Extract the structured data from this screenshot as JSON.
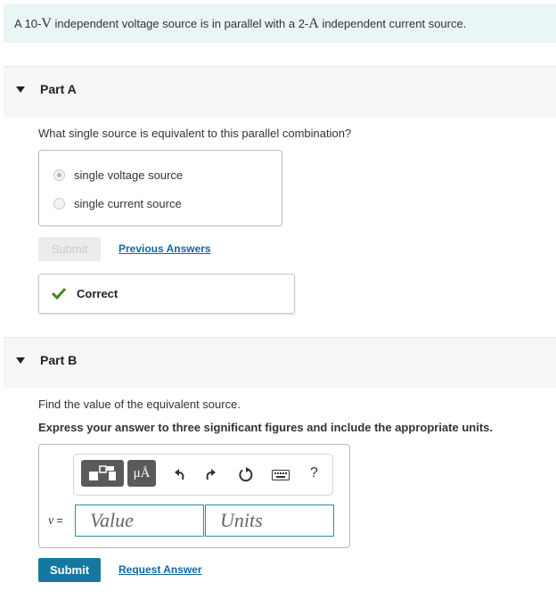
{
  "intro": {
    "pre_v": "A 10-",
    "v_symbol": "V",
    "mid": " independent voltage source is in parallel with a 2-",
    "a_symbol": "A",
    "post": " independent current source."
  },
  "part_a": {
    "label": "Part A",
    "question": "What single source is equivalent to this parallel combination?",
    "choices": [
      {
        "label": "single voltage source",
        "selected": true
      },
      {
        "label": "single current source",
        "selected": false
      }
    ],
    "submit_label": "Submit",
    "previous_answers_label": "Previous Answers",
    "feedback": "Correct",
    "feedback_color": "#3b8a1e"
  },
  "part_b": {
    "label": "Part B",
    "question": "Find the value of the equivalent source.",
    "instruction": "Express your answer to three significant figures and include the appropriate units.",
    "toolbar": {
      "templates_icon": "templates-icon",
      "units_icon": "μÅ",
      "undo_icon": "undo-icon",
      "redo_icon": "redo-icon",
      "reset_icon": "reset-icon",
      "keyboard_icon": "keyboard-icon",
      "help_label": "?"
    },
    "variable": "v",
    "equals": " =",
    "value_placeholder": "Value",
    "units_placeholder": "Units",
    "submit_label": "Submit",
    "request_answer_label": "Request Answer",
    "accent_color": "#1478a1"
  }
}
